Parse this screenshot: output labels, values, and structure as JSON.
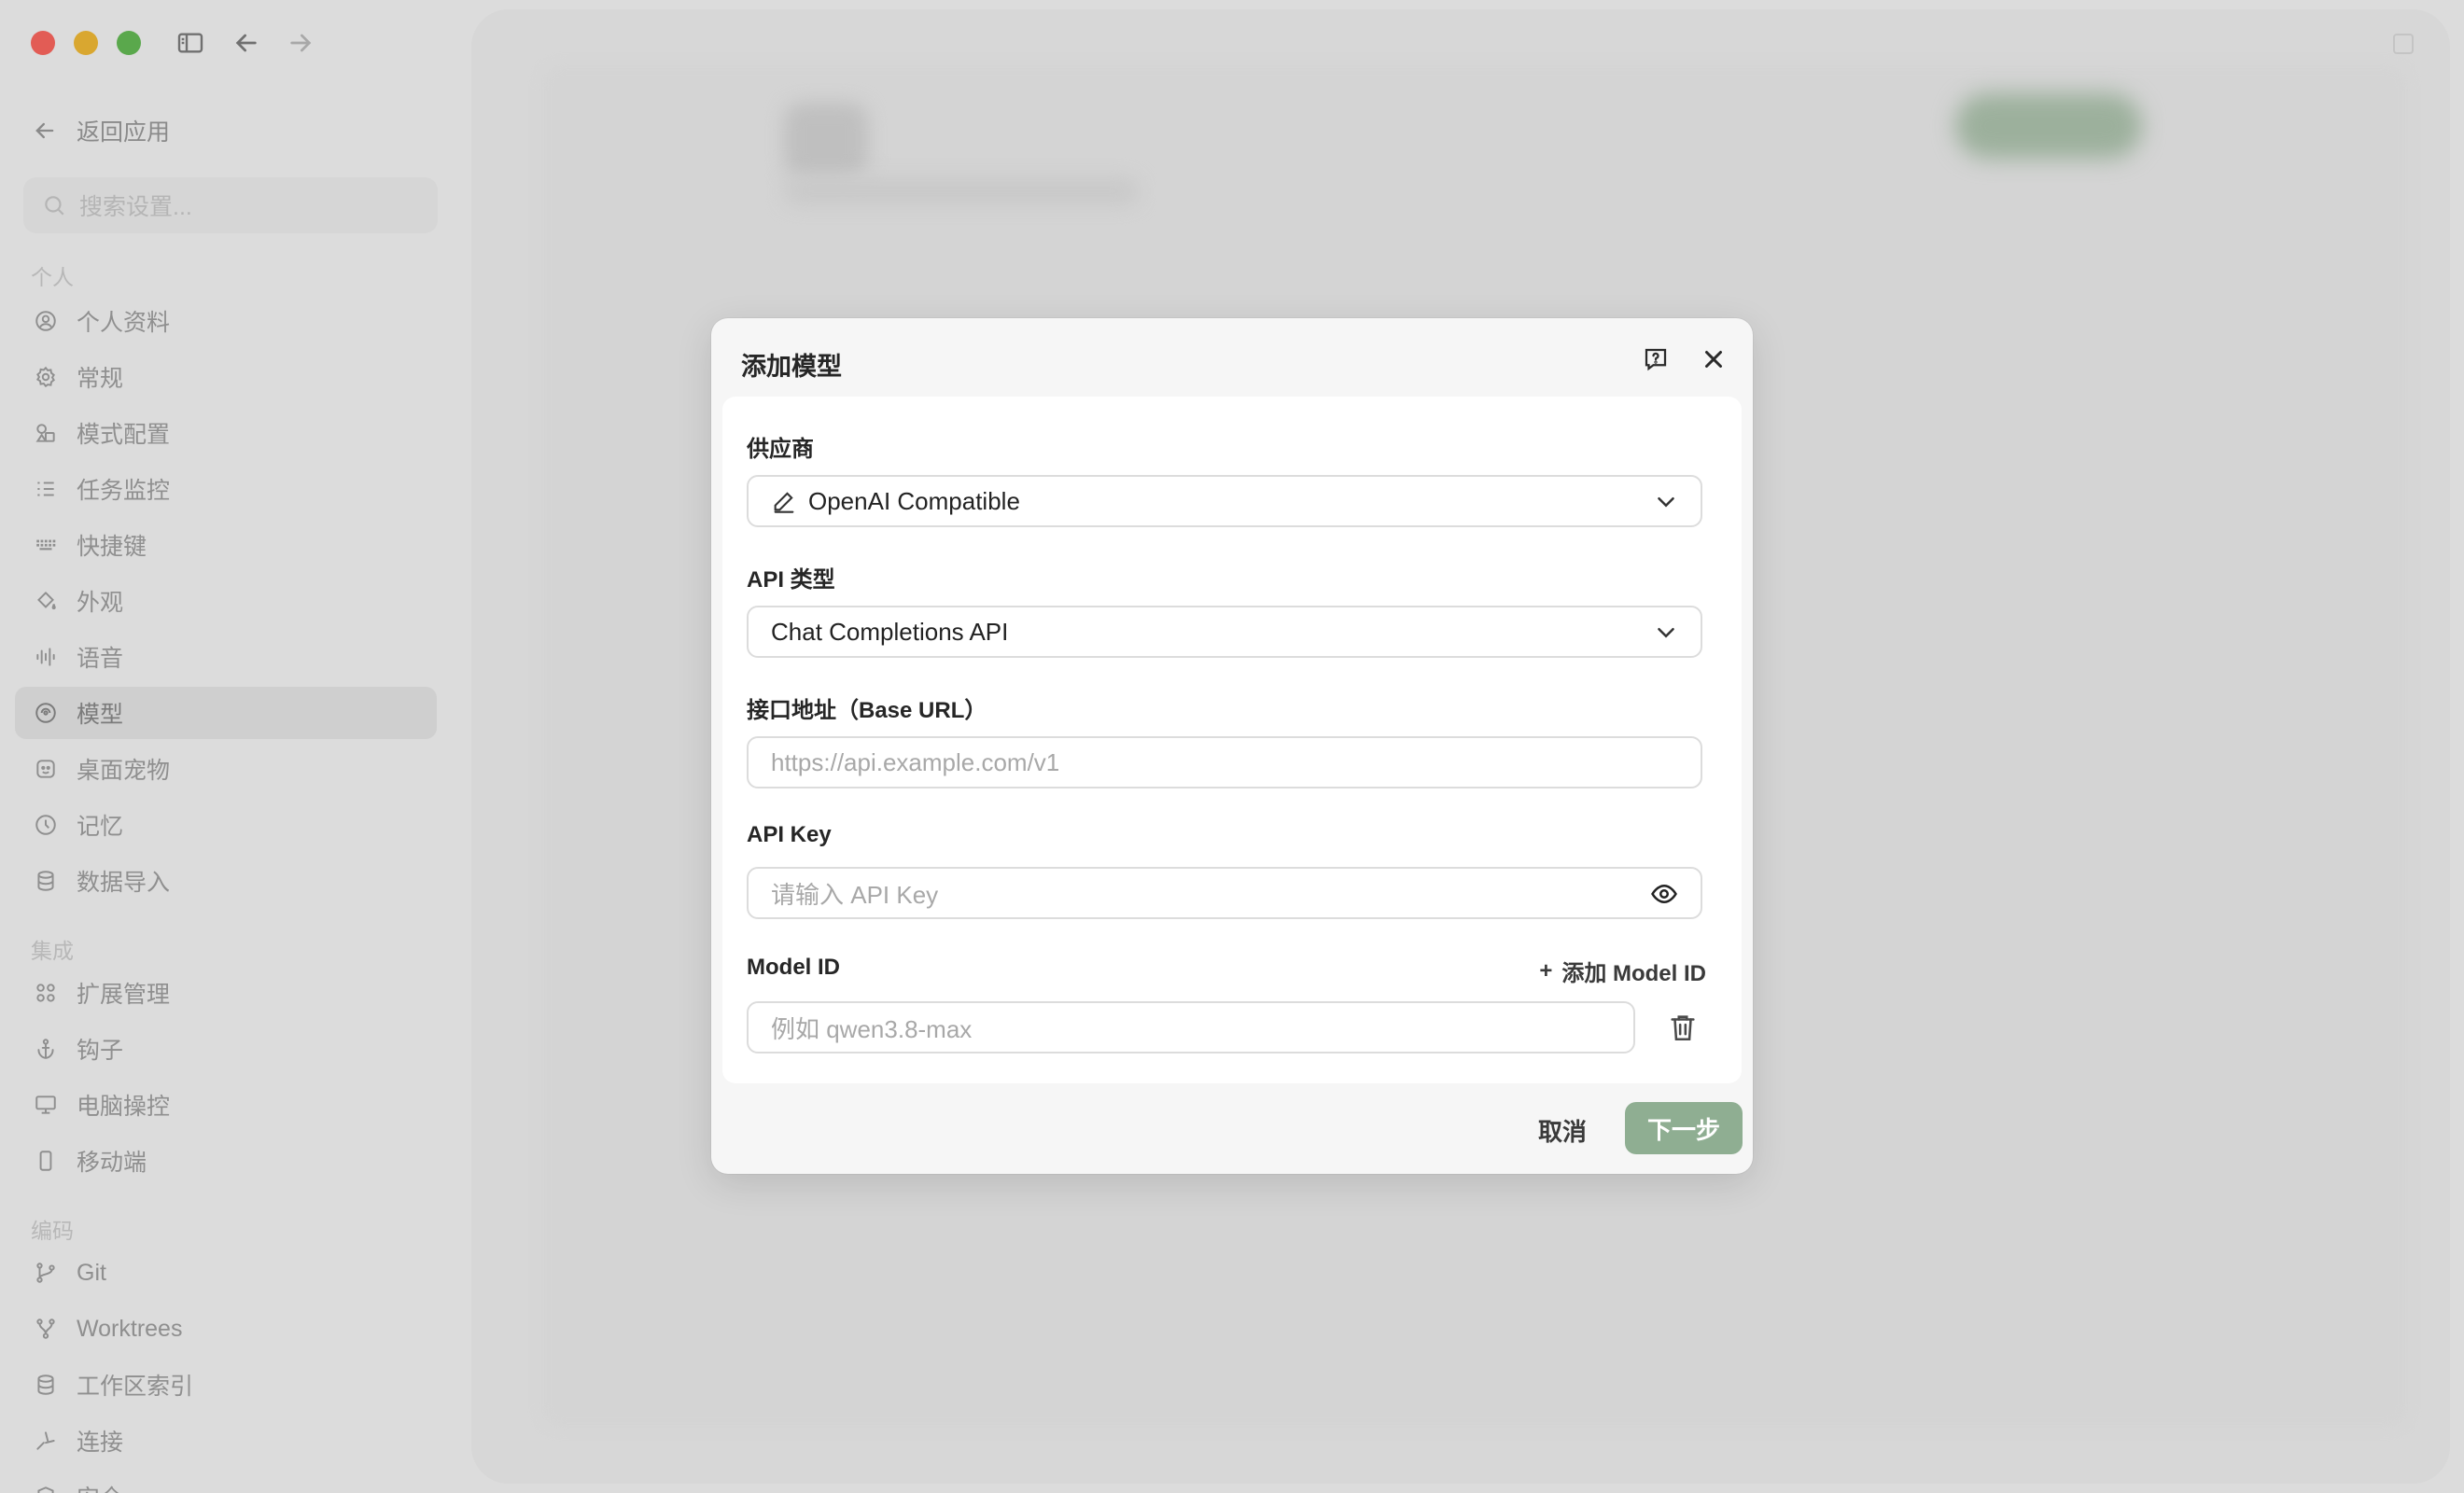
{
  "sidebar": {
    "back_label": "返回应用",
    "search_placeholder": "搜索设置...",
    "sections": [
      {
        "label": "个人"
      },
      {
        "label": "集成"
      },
      {
        "label": "编码"
      }
    ],
    "items": [
      {
        "label": "个人资料",
        "icon": "user-circle-icon"
      },
      {
        "label": "常规",
        "icon": "gear-icon"
      },
      {
        "label": "模式配置",
        "icon": "shapes-icon"
      },
      {
        "label": "任务监控",
        "icon": "list-check-icon"
      },
      {
        "label": "快捷键",
        "icon": "keyboard-icon"
      },
      {
        "label": "外观",
        "icon": "paint-bucket-icon"
      },
      {
        "label": "语音",
        "icon": "audio-wave-icon"
      },
      {
        "label": "模型",
        "icon": "model-icon",
        "active": true
      },
      {
        "label": "桌面宠物",
        "icon": "pet-icon"
      },
      {
        "label": "记忆",
        "icon": "memory-icon"
      },
      {
        "label": "数据导入",
        "icon": "database-icon"
      },
      {
        "label": "扩展管理",
        "icon": "grid-icon"
      },
      {
        "label": "钩子",
        "icon": "anchor-icon"
      },
      {
        "label": "电脑操控",
        "icon": "monitor-icon"
      },
      {
        "label": "移动端",
        "icon": "phone-icon"
      },
      {
        "label": "Git",
        "icon": "git-branch-icon"
      },
      {
        "label": "Worktrees",
        "icon": "worktree-icon"
      },
      {
        "label": "工作区索引",
        "icon": "database-icon"
      },
      {
        "label": "连接",
        "icon": "plug-icon"
      },
      {
        "label": "安全",
        "icon": "shield-icon"
      }
    ]
  },
  "modal": {
    "title": "添加模型",
    "provider": {
      "label": "供应商",
      "value": "OpenAI Compatible"
    },
    "api_type": {
      "label": "API 类型",
      "value": "Chat Completions API"
    },
    "base_url": {
      "label": "接口地址（Base URL）",
      "placeholder": "https://api.example.com/v1"
    },
    "api_key": {
      "label": "API Key",
      "placeholder": "请输入 API Key"
    },
    "model_id": {
      "label": "Model ID",
      "add_label": "添加 Model ID",
      "placeholder": "例如 qwen3.8-max"
    },
    "cancel_label": "取消",
    "next_label": "下一步",
    "next_color": "#8fae92"
  }
}
